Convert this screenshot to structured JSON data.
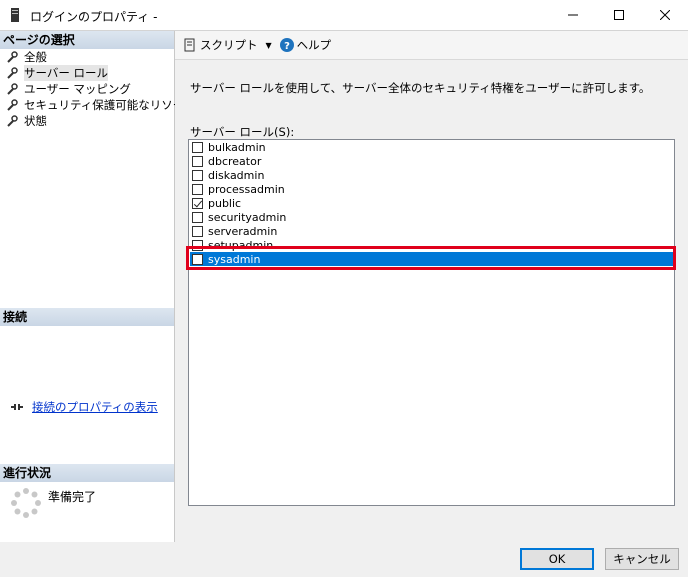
{
  "window": {
    "title": "ログインのプロパティ -"
  },
  "left": {
    "pages_header": "ページの選択",
    "pages": [
      {
        "label": "全般"
      },
      {
        "label": "サーバー ロール"
      },
      {
        "label": "ユーザー マッピング"
      },
      {
        "label": "セキュリティ保護可能なリソース"
      },
      {
        "label": "状態"
      }
    ],
    "connection_header": "接続",
    "connection_link": "接続のプロパティの表示",
    "progress_header": "進行状況",
    "progress_status": "準備完了"
  },
  "toolbar": {
    "script_label": "スクリプト",
    "help_label": "ヘルプ"
  },
  "main": {
    "description": "サーバー ロールを使用して、サーバー全体のセキュリティ特権をユーザーに許可します。",
    "list_label": "サーバー ロール(S):",
    "roles": [
      {
        "name": "bulkadmin",
        "checked": false
      },
      {
        "name": "dbcreator",
        "checked": false
      },
      {
        "name": "diskadmin",
        "checked": false
      },
      {
        "name": "processadmin",
        "checked": false
      },
      {
        "name": "public",
        "checked": true
      },
      {
        "name": "securityadmin",
        "checked": false
      },
      {
        "name": "serveradmin",
        "checked": false
      },
      {
        "name": "setupadmin",
        "checked": false
      },
      {
        "name": "sysadmin",
        "checked": false
      }
    ],
    "selected_role": "sysadmin"
  },
  "buttons": {
    "ok": "OK",
    "cancel": "キャンセル"
  },
  "colors": {
    "selection": "#0078d7",
    "highlight_box": "#e0001b",
    "link": "#0033cc"
  }
}
